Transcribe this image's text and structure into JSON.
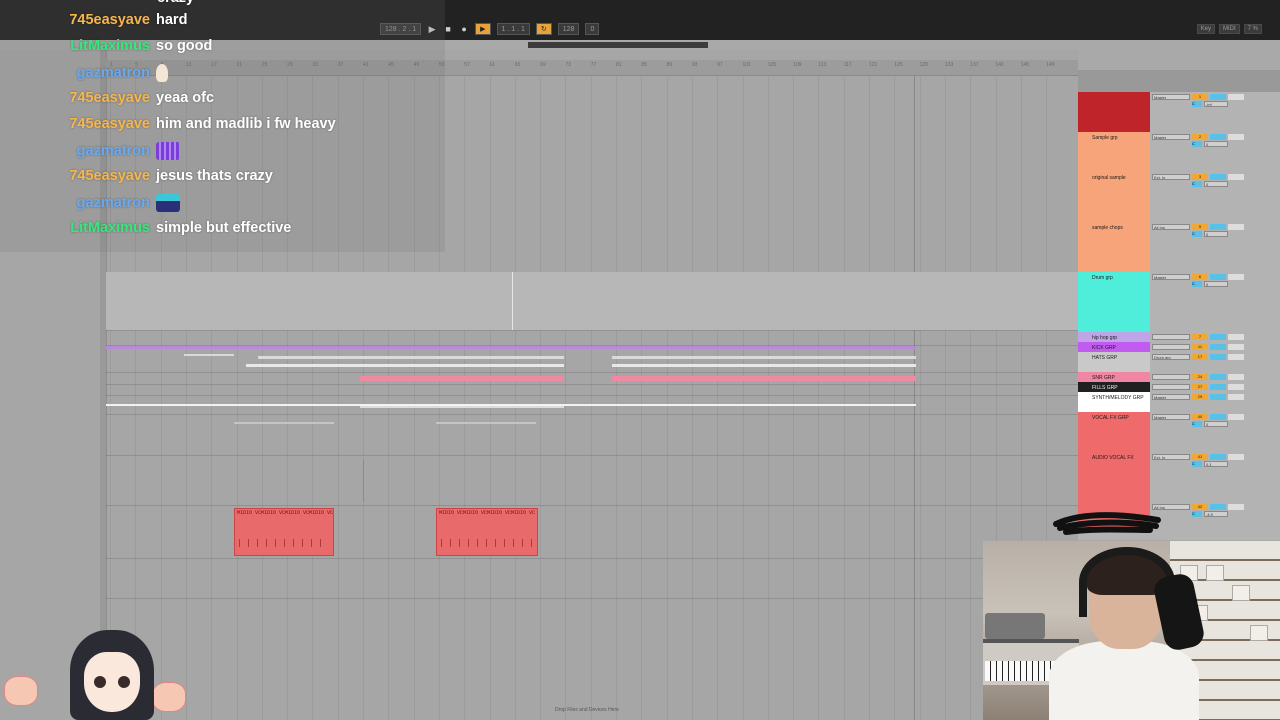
{
  "transport": {
    "tempo": "128 . 2 . 1",
    "position": "1 . 1 . 1",
    "bpm": "128",
    "percent": "0",
    "play_icon": "play-icon",
    "stop_icon": "stop-icon",
    "record_icon": "record-icon"
  },
  "right_tools": {
    "key": "Key",
    "midi": "MIDI",
    "cpu": "7 %"
  },
  "ruler": {
    "ticks": [
      "1",
      "5",
      "9",
      "13",
      "17",
      "21",
      "25",
      "29",
      "33",
      "37",
      "41",
      "45",
      "49",
      "53",
      "57",
      "61",
      "65",
      "69",
      "73",
      "77",
      "81",
      "85",
      "89",
      "93",
      "97",
      "101",
      "105",
      "109",
      "113",
      "117",
      "121",
      "125",
      "129",
      "133",
      "137",
      "141",
      "145",
      "149"
    ]
  },
  "tracks": [
    {
      "name": "",
      "color": "#c0242b",
      "route": "Master",
      "num": "1",
      "a": "-inf",
      "b": "C"
    },
    {
      "name": "Sample grp",
      "color": "#f7a47a",
      "route": "Master",
      "num": "2",
      "a": "0",
      "b": "C"
    },
    {
      "name": "original sample",
      "color": "#f7a47a",
      "route": "Ext. In",
      "num": "3",
      "a": "0",
      "b": "C"
    },
    {
      "name": "sample chops",
      "color": "#f7a47a",
      "route": "All Ins",
      "num": "5",
      "a": "0",
      "b": "C"
    },
    {
      "name": "Drum grp",
      "color": "#4eeedb",
      "route": "Master",
      "num": "6",
      "a": "0",
      "b": "C"
    },
    {
      "name": "hip hop grp",
      "color": "#bfa4e8",
      "route": "",
      "num": "7",
      "a": "",
      "b": ""
    },
    {
      "name": "KICK GRP",
      "color": "#c25cf0",
      "route": "",
      "num": "11",
      "a": "",
      "b": ""
    },
    {
      "name": "HATS GRP",
      "color": "#c9c9c9",
      "route": "Drum grp",
      "num": "17",
      "a": "",
      "b": ""
    },
    {
      "name": "SNR GRP",
      "color": "#f186a4",
      "route": "",
      "num": "24",
      "a": "",
      "b": ""
    },
    {
      "name": "FILLS GRP",
      "color": "#202020",
      "route": "",
      "num": "27",
      "a": "",
      "b": ""
    },
    {
      "name": "SYNTH/MELODY GRP",
      "color": "#ffffff",
      "route": "Master",
      "num": "29",
      "a": "0",
      "b": "C"
    },
    {
      "name": "VOCAL FX GRP",
      "color": "#ef6b6b",
      "route": "Master",
      "num": "40",
      "a": "0",
      "b": "C"
    },
    {
      "name": "AUDIO VOCAL FX",
      "color": "#ef6b6b",
      "route": "Ext. In",
      "num": "41",
      "a": "0.1",
      "b": "C"
    },
    {
      "name": "",
      "color": "#ef6b6b",
      "route": "All Ins",
      "num": "42",
      "a": "-4.9",
      "b": "C"
    }
  ],
  "clips": {
    "midi_label": "MIDIO VCMIDIO VCMIDIO VCMIDIO VC"
  },
  "drop_hint": "Drop Files and Devices Here",
  "chat": {
    "top_partial": "crazy",
    "messages": [
      {
        "user": "745easyave",
        "user_color": "#f7b64c",
        "text": "hard",
        "emote": ""
      },
      {
        "user": "LitMaximus",
        "user_color": "#34e87a",
        "text": "so good",
        "emote": ""
      },
      {
        "user": "gazmatron",
        "user_color": "#6aa9f0",
        "text": "",
        "emote": "thumbs-up-emote"
      },
      {
        "user": "745easyave",
        "user_color": "#f7b64c",
        "text": "yeaa ofc",
        "emote": ""
      },
      {
        "user": "745easyave",
        "user_color": "#f7b64c",
        "text": "him and madlib i fw heavy",
        "emote": ""
      },
      {
        "user": "gazmatron",
        "user_color": "#6aa9f0",
        "text": "",
        "emote": "purple-emote"
      },
      {
        "user": "745easyave",
        "user_color": "#f7b64c",
        "text": "jesus thats crazy",
        "emote": ""
      },
      {
        "user": "gazmatron",
        "user_color": "#6aa9f0",
        "text": "",
        "emote": "robot-emote"
      },
      {
        "user": "LitMaximus",
        "user_color": "#34e87a",
        "text": "simple but effective",
        "emote": ""
      }
    ]
  }
}
